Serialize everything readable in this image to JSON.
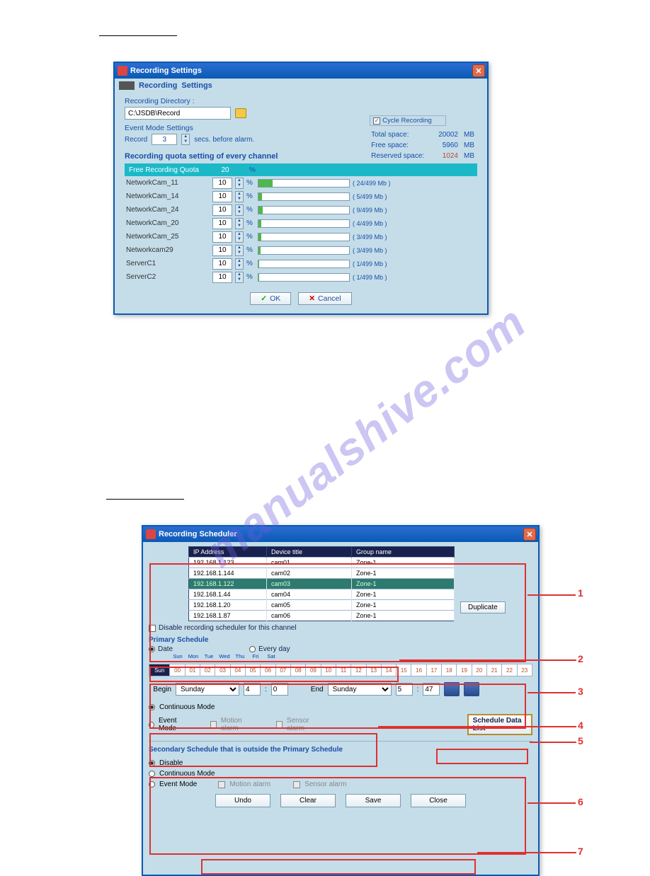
{
  "dialog1": {
    "title": "Recording Settings",
    "tabRecording": "Recording",
    "tabSettings": "Settings",
    "recDirLbl": "Recording Directory :",
    "recDirVal": "C:\\JSDB\\Record",
    "evModeTitle": "Event Mode Settings",
    "evRecordLbl": "Record",
    "evSeconds": "3",
    "evSecSuffix": "secs. before alarm.",
    "quotaTitle": "Recording quota setting of every channel",
    "freeQuotaLbl": "Free Recording Quota",
    "freeQuotaVal": "20",
    "cycleRecLbl": "Cycle Recording",
    "statTotal": "Total space:",
    "statTotalV": "20002",
    "statFree": "Free space:",
    "statFreeV": "5960",
    "statRes": "Reserved space:",
    "statResV": "1024",
    "unit": "MB",
    "okLbl": "OK",
    "cancelLbl": "Cancel",
    "rows": [
      {
        "name": "NetworkCam_11",
        "pct": "10",
        "bar": 16,
        "lbl": "( 24/499 Mb )"
      },
      {
        "name": "NetworkCam_14",
        "pct": "10",
        "bar": 4,
        "lbl": "( 5/499 Mb )"
      },
      {
        "name": "NetworkCam_24",
        "pct": "10",
        "bar": 5,
        "lbl": "( 9/499 Mb )"
      },
      {
        "name": "NetworkCam_20",
        "pct": "10",
        "bar": 3,
        "lbl": "( 4/499 Mb )"
      },
      {
        "name": "NetworkCam_25",
        "pct": "10",
        "bar": 3,
        "lbl": "( 3/499 Mb )"
      },
      {
        "name": "Networkcam29",
        "pct": "10",
        "bar": 2,
        "lbl": "( 3/499 Mb )"
      },
      {
        "name": "ServerC1",
        "pct": "10",
        "bar": 1,
        "lbl": "( 1/499 Mb )"
      },
      {
        "name": "ServerC2",
        "pct": "10",
        "bar": 1,
        "lbl": "( 1/499 Mb )"
      }
    ]
  },
  "dialog2": {
    "title": "Recording Scheduler",
    "thIp": "IP Address",
    "thDev": "Device title",
    "thGroup": "Group name",
    "rows": [
      {
        "ip": "192.168.1.123",
        "dev": "cam01",
        "grp": "Zone-1",
        "sel": false
      },
      {
        "ip": "192.168.1.144",
        "dev": "cam02",
        "grp": "Zone-1",
        "sel": false
      },
      {
        "ip": "192.168.1.122",
        "dev": "cam03",
        "grp": "Zone-1",
        "sel": true
      },
      {
        "ip": "192.168.1.44",
        "dev": "cam04",
        "grp": "Zone-1",
        "sel": false
      },
      {
        "ip": "192.168.1.20",
        "dev": "cam05",
        "grp": "Zone-1",
        "sel": false
      },
      {
        "ip": "192.168.1.87",
        "dev": "cam06",
        "grp": "Zone-1",
        "sel": false
      }
    ],
    "dupBtn": "Duplicate",
    "disableChkLbl": "Disable recording scheduler for this channel",
    "primTitle": "Primary Schedule",
    "optDate": "Date",
    "optEvery": "Every day",
    "days": [
      "Sun",
      "Mon",
      "Tue",
      "Wed",
      "Thu",
      "Fri",
      "Sat"
    ],
    "hours": [
      "00",
      "01",
      "02",
      "03",
      "04",
      "05",
      "06",
      "07",
      "08",
      "09",
      "10",
      "11",
      "12",
      "13",
      "14",
      "15",
      "16",
      "17",
      "18",
      "19",
      "20",
      "21",
      "22",
      "23"
    ],
    "beginLbl": "Begin",
    "endLbl": "End",
    "daySunday": "Sunday",
    "h4": "4",
    "m0": "0",
    "h5": "5",
    "m47": "47",
    "contMode": "Continuous Mode",
    "evMode": "Event Mode",
    "motionAlarm": "Motion alarm",
    "sensorAlarm": "Sensor alarm",
    "schedDataBtn": "Schedule Data List",
    "secTitle": "Secondary Schedule that is outside the Primary Schedule",
    "optDisable": "Disable",
    "undo": "Undo",
    "clear": "Clear",
    "save": "Save",
    "close": "Close",
    "callouts": {
      "c1": "1",
      "c2": "2",
      "c3": "3",
      "c4": "4",
      "c5": "5",
      "c6": "6",
      "c7": "7"
    }
  },
  "watermark": "manualshive.com"
}
